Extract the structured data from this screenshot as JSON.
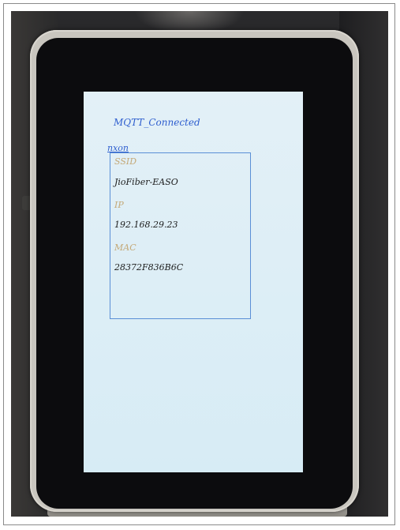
{
  "screen": {
    "status": "MQTT_Connected",
    "device_name": "nxon",
    "fields": [
      {
        "label": "SSID",
        "value": "JioFiber-EASO"
      },
      {
        "label": "IP",
        "value": "192.168.29.23"
      },
      {
        "label": "MAC",
        "value": "28372F836B6C"
      }
    ]
  },
  "colors": {
    "status_text": "#2f5fcf",
    "field_label": "#c4a978",
    "field_value": "#1c1c1c",
    "box_border": "#5a8fd6",
    "screen_bg": "#e0eff6",
    "bezel": "#0c0c0e"
  }
}
